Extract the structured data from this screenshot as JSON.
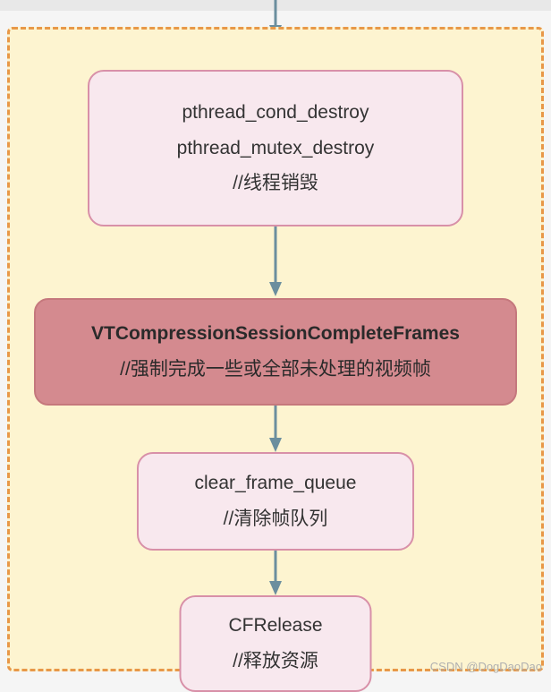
{
  "nodes": {
    "destroy": {
      "line1": "pthread_cond_destroy",
      "line2": "pthread_mutex_destroy",
      "comment": "//线程销毁"
    },
    "complete": {
      "title": "VTCompressionSessionCompleteFrames",
      "comment": "//强制完成一些或全部未处理的视频帧"
    },
    "clear": {
      "title": "clear_frame_queue",
      "comment": "//清除帧队列"
    },
    "release": {
      "title": "CFRelease",
      "comment": "//释放资源"
    }
  },
  "watermark": "CSDN @DogDaoDao",
  "colors": {
    "arrow": "#6b8e9e",
    "container_bg": "#fdf4d0",
    "container_border": "#e89848",
    "node_pink_bg": "#f8e8ee",
    "node_pink_border": "#d890a8",
    "node_red_bg": "#d48a8f"
  }
}
